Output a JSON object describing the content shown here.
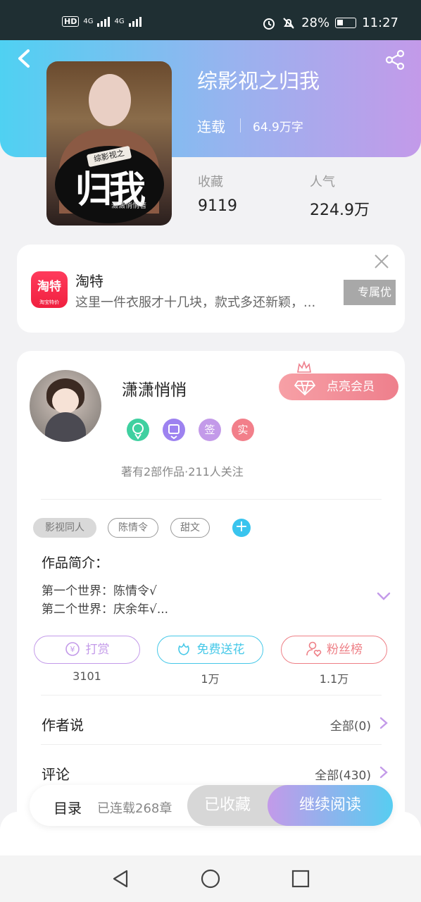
{
  "status_bar": {
    "left": "HD",
    "net1": "4G",
    "net2": "4G",
    "battery": "28%",
    "time": "11:27"
  },
  "header": {
    "back_icon": "back-chevron-icon",
    "share_icon": "share-icon",
    "title": "综影视之归我",
    "status": "连载",
    "word_count": "64.9万字",
    "cover": {
      "title_text": "归我",
      "series_text": "综影视之",
      "author_text": "潇潇悄悄著"
    },
    "stats": [
      {
        "label": "收藏",
        "value": "9119"
      },
      {
        "label": "人气",
        "value": "224.9万"
      }
    ]
  },
  "ad": {
    "logo_text": "淘特",
    "logo_sub": "淘宝特价",
    "name": "淘特",
    "description": "这里一件衣服才十几块，款式多还新颖，...",
    "button": "专属优"
  },
  "author": {
    "name": "潇潇悄悄",
    "vip_button": "点亮会员",
    "badges": [
      {
        "icon": "green-medal-icon",
        "text": "",
        "color": "#3fd0a0"
      },
      {
        "icon": "purple-medal-icon",
        "text": "",
        "color": "#9d82f0"
      },
      {
        "icon": "sign-badge-icon",
        "text": "签",
        "color": "#c39ae9"
      },
      {
        "icon": "verified-badge-icon",
        "text": "实",
        "color": "#f27f8a"
      }
    ],
    "meta": "著有2部作品·211人关注"
  },
  "tags": [
    {
      "label": "影视同人",
      "style": "filled"
    },
    {
      "label": "陈情令",
      "style": "outline"
    },
    {
      "label": "甜文",
      "style": "outline"
    }
  ],
  "intro": {
    "label": "作品简介：",
    "lines": [
      "第一个世界：陈情令√",
      "第二个世界：庆余年√..."
    ]
  },
  "actions": [
    {
      "label": "打赏",
      "count": "3101",
      "color": "#c39ae9",
      "icon": "yen-coin-icon"
    },
    {
      "label": "免费送花",
      "count": "1万",
      "color": "#45c8e8",
      "icon": "flower-icon"
    },
    {
      "label": "粉丝榜",
      "count": "1.1万",
      "color": "#ee7f86",
      "icon": "fan-user-icon"
    }
  ],
  "rows": [
    {
      "label": "作者说",
      "right": "全部(0)"
    },
    {
      "label": "评论",
      "right": "全部(430)"
    }
  ],
  "bottom_bar": {
    "toc": "目录",
    "toc_count": "已连载268章",
    "favorited": "已收藏",
    "continue_reading": "继续阅读"
  },
  "colors": {
    "accent_purple": "#c39ae9",
    "accent_cyan": "#57cdf1",
    "vip_pink": "#ee7f8c"
  }
}
